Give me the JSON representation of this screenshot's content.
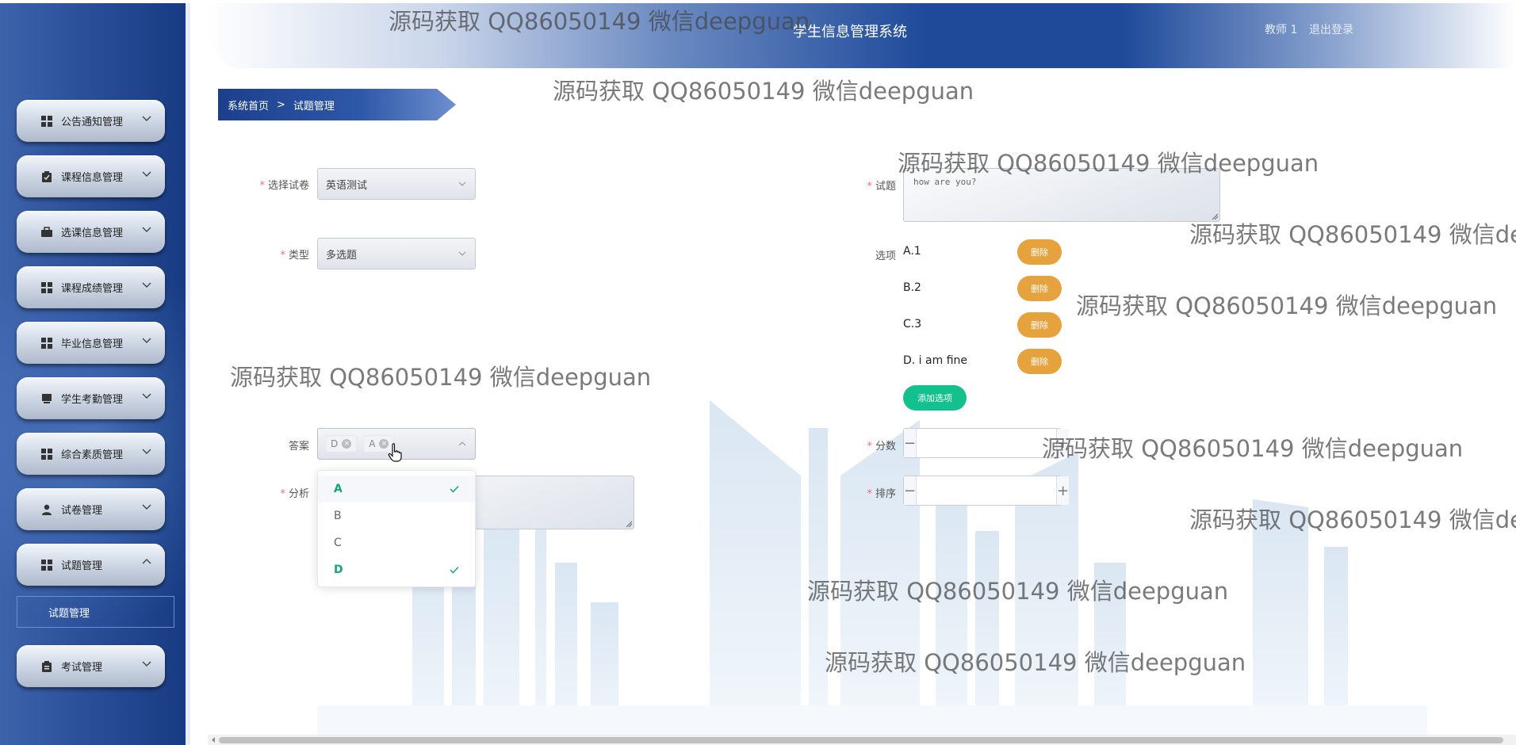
{
  "sidebar": {
    "items": [
      {
        "label": "公告通知管理",
        "icon": "grid-icon",
        "expanded": false
      },
      {
        "label": "课程信息管理",
        "icon": "clipboard-check-icon",
        "expanded": false
      },
      {
        "label": "选课信息管理",
        "icon": "briefcase-icon",
        "expanded": false
      },
      {
        "label": "课程成绩管理",
        "icon": "grid-icon",
        "expanded": false
      },
      {
        "label": "毕业信息管理",
        "icon": "grid-icon",
        "expanded": false
      },
      {
        "label": "学生考勤管理",
        "icon": "monitor-icon",
        "expanded": false
      },
      {
        "label": "综合素质管理",
        "icon": "grid-icon",
        "expanded": false
      },
      {
        "label": "试卷管理",
        "icon": "user-icon",
        "expanded": false
      },
      {
        "label": "试题管理",
        "icon": "grid-icon",
        "expanded": true
      },
      {
        "label": "考试管理",
        "icon": "clipboard-icon",
        "expanded": false
      }
    ],
    "submenu": {
      "label": "试题管理"
    }
  },
  "header": {
    "title": "学生信息管理系统",
    "user": "教师 1",
    "logout": "退出登录"
  },
  "breadcrumb": {
    "home": "系统首页",
    "separator": ">",
    "current": "试题管理"
  },
  "form": {
    "paper": {
      "label": "选择试卷",
      "value": "英语测试"
    },
    "type": {
      "label": "类型",
      "value": "多选题"
    },
    "question": {
      "label": "试题",
      "value": "how are you?"
    },
    "options": {
      "label": "选项",
      "items": [
        {
          "text": "A.1",
          "delete": "删除"
        },
        {
          "text": "B.2",
          "delete": "删除"
        },
        {
          "text": "C.3",
          "delete": "删除"
        },
        {
          "text": "D. i am fine",
          "delete": "删除"
        }
      ],
      "add_label": "添加选项"
    },
    "answer": {
      "label": "答案",
      "tags": [
        "D",
        "A"
      ],
      "dropdown": [
        {
          "label": "A",
          "selected": true
        },
        {
          "label": "B",
          "selected": false
        },
        {
          "label": "C",
          "selected": false
        },
        {
          "label": "D",
          "selected": true
        }
      ]
    },
    "analysis": {
      "label": "分析",
      "value": ""
    },
    "score": {
      "label": "分数",
      "value": "",
      "minus": "−",
      "plus": "+"
    },
    "order": {
      "label": "排序",
      "value": "",
      "minus": "−",
      "plus": "+"
    }
  },
  "watermark": {
    "text": "源码获取 QQ86050149 微信deepguan",
    "text_truncated": "源码获取 QQ86050149 微信de"
  },
  "colors": {
    "sidebar": "#2a4f98",
    "header_accent": "#1f4a9a",
    "delete_button": "#e6a23c",
    "add_button": "#13c18f",
    "required": "#f56c6c",
    "selected_option": "#13a67e"
  }
}
